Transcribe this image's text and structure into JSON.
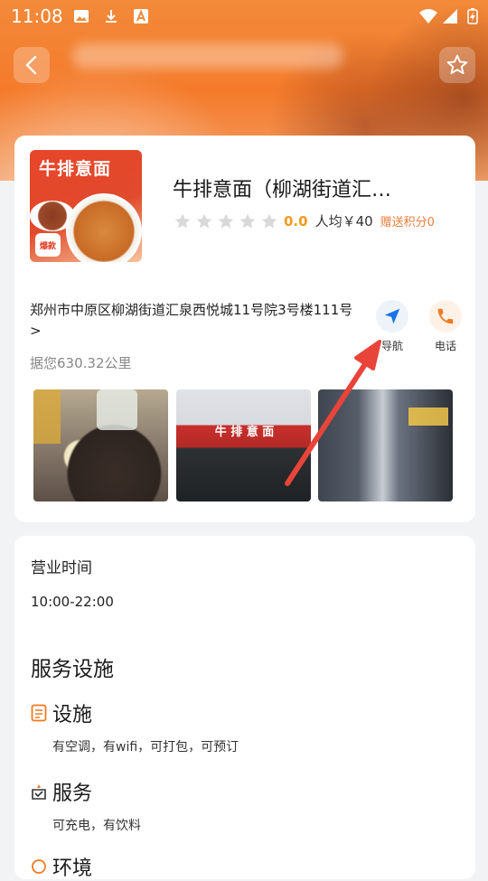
{
  "status_bar": {
    "time": "11:08"
  },
  "shop": {
    "name": "牛排意面（柳湖街道汇…",
    "score": "0.0",
    "avg_price": "人均￥40",
    "bonus": "赠送积分0",
    "stars_filled": 0,
    "stars_total": 5,
    "address": "郑州市中原区柳湖街道汇泉西悦城11号院3号楼111号 >",
    "distance": "据您630.32公里",
    "poster": {
      "title": "牛排意面",
      "badge": "爆款"
    }
  },
  "actions": {
    "navigate": {
      "label": "导航",
      "icon": "navigation-arrow-icon",
      "color": "#1a73e8"
    },
    "phone": {
      "label": "电话",
      "icon": "phone-icon",
      "color": "#f07a22"
    }
  },
  "photos": [
    {
      "name": "food-photo"
    },
    {
      "name": "storefront-photo",
      "sign": "牛 排 意 面"
    },
    {
      "name": "interior-photo"
    }
  ],
  "hours": {
    "title": "营业时间",
    "value": "10:00-22:00"
  },
  "services": {
    "title": "服务设施",
    "items": [
      {
        "title": "设施",
        "desc": "有空调，有wifi，可打包，可预订",
        "icon": "facility-icon"
      },
      {
        "title": "服务",
        "desc": "可充电，有饮料",
        "icon": "service-icon"
      },
      {
        "title": "环境",
        "desc": "",
        "icon": "environment-icon"
      }
    ]
  },
  "colors": {
    "accent_orange": "#f39a1e",
    "bonus_orange": "#ef7d3c",
    "annotation_red": "#e8443a"
  }
}
